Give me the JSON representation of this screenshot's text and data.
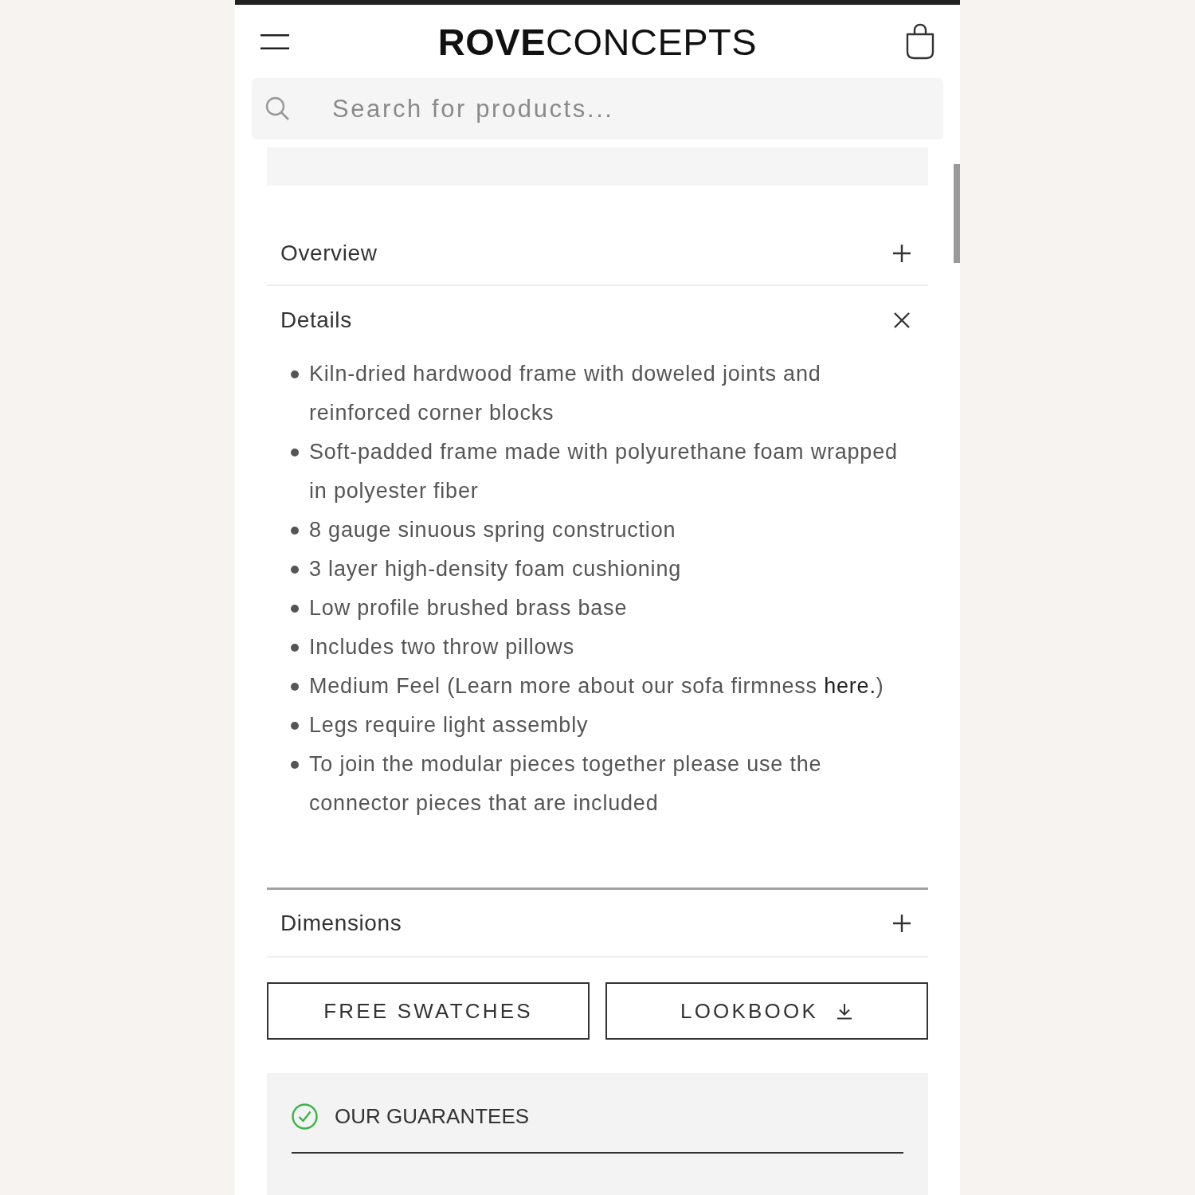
{
  "header": {
    "logo": "**ROVE**CONCEPTS"
  },
  "search": {
    "placeholder": "Search for products..."
  },
  "accordion": [
    {
      "title": "Overview",
      "expanded": false
    },
    {
      "title": "Details",
      "expanded": true,
      "bullets": [
        {
          "text": "Kiln-dried hardwood frame with doweled joints and reinforced corner blocks"
        },
        {
          "text": "Soft-padded frame made with polyurethane foam wrapped in polyester fiber"
        },
        {
          "text": "8 gauge sinuous spring construction"
        },
        {
          "text": "3 layer high-density foam cushioning"
        },
        {
          "text": "Low profile brushed brass base"
        },
        {
          "text": "Includes two throw pillows"
        },
        {
          "text": "Medium Feel (Learn more about our sofa firmness ",
          "link": "here.",
          "text_after": ")"
        },
        {
          "text": "Legs require light assembly"
        },
        {
          "text": "To join the modular pieces together please use the connector pieces that are included"
        }
      ]
    },
    {
      "title": "Dimensions",
      "expanded": false
    }
  ],
  "buttons": [
    {
      "label": "FREE SWATCHES",
      "kind": "plain"
    },
    {
      "label": "LOOKBOOK",
      "kind": "download"
    }
  ],
  "guarantees": {
    "title": "OUR GUARANTEES"
  }
}
